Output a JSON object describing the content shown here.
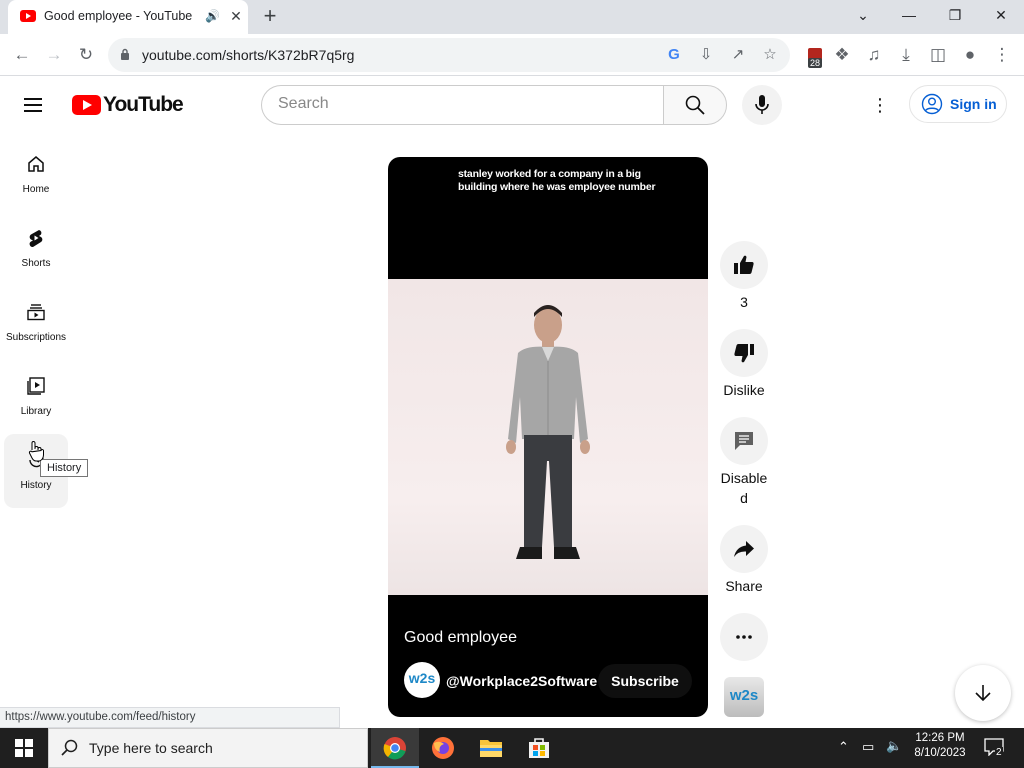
{
  "browser": {
    "tab_title": "Good employee - YouTube",
    "url": "youtube.com/shorts/K372bR7q5rg",
    "extension_badge_count": "28",
    "status_url": "https://www.youtube.com/feed/history"
  },
  "masthead": {
    "logo_text": "YouTube",
    "search_placeholder": "Search",
    "sign_in": "Sign in"
  },
  "sidebar": {
    "items": [
      {
        "label": "Home",
        "icon": "home-icon"
      },
      {
        "label": "Shorts",
        "icon": "shorts-icon"
      },
      {
        "label": "Subscriptions",
        "icon": "subscriptions-icon"
      },
      {
        "label": "Library",
        "icon": "library-icon"
      },
      {
        "label": "History",
        "icon": "history-icon"
      }
    ],
    "tooltip": "History"
  },
  "short": {
    "caption": "stanley worked for a company in a big building where he was employee number",
    "title": "Good employee",
    "channel": "@Workplace2Software",
    "channel_avatar_text": "w2s",
    "subscribe": "Subscribe"
  },
  "actions": {
    "like_count": "3",
    "dislike": "Dislike",
    "comments": "Disabled",
    "share": "Share"
  },
  "taskbar": {
    "search_placeholder": "Type here to search",
    "time": "12:26 PM",
    "date": "8/10/2023",
    "notification_count": "2"
  },
  "colors": {
    "brand_red": "#ff0000",
    "link_blue": "#065fd4",
    "taskbar": "#1f1f1f"
  }
}
